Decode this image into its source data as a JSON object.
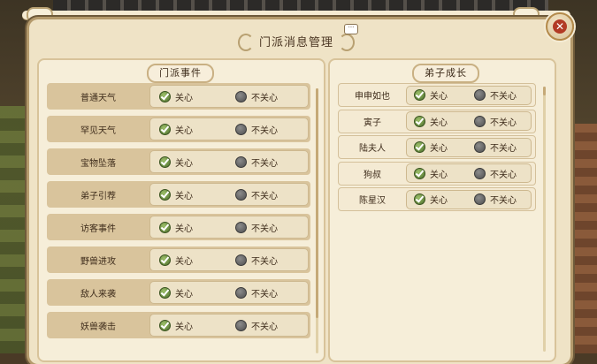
{
  "dialog": {
    "title": "门派消息管理"
  },
  "left_panel": {
    "header": "门派事件",
    "items": [
      {
        "label": "普通天气",
        "selected": "care"
      },
      {
        "label": "罕见天气",
        "selected": "care"
      },
      {
        "label": "宝物坠落",
        "selected": "care"
      },
      {
        "label": "弟子引荐",
        "selected": "care"
      },
      {
        "label": "访客事件",
        "selected": "care"
      },
      {
        "label": "野兽进攻",
        "selected": "care"
      },
      {
        "label": "敌人来袭",
        "selected": "care"
      },
      {
        "label": "妖兽袭击",
        "selected": "care"
      }
    ],
    "care_label": "关心",
    "nocare_label": "不关心"
  },
  "right_panel": {
    "header": "弟子成长",
    "items": [
      {
        "label": "申申如也",
        "selected": "care"
      },
      {
        "label": "寅子",
        "selected": "care"
      },
      {
        "label": "陆夫人",
        "selected": "care"
      },
      {
        "label": "狗叔",
        "selected": "care"
      },
      {
        "label": "陈星汉",
        "selected": "care"
      }
    ],
    "care_label": "关心",
    "nocare_label": "不关心"
  },
  "icons": {
    "close": "close-icon",
    "chat": "chat-bubble-icon",
    "checked_radio": "green-check-radio-icon",
    "unchecked_radio": "gray-radio-icon"
  },
  "colors": {
    "panel_bg": "#efe3c6",
    "row_bg": "#d9c49c",
    "check_green": "#4b6d2a",
    "close_red": "#b23a24"
  }
}
